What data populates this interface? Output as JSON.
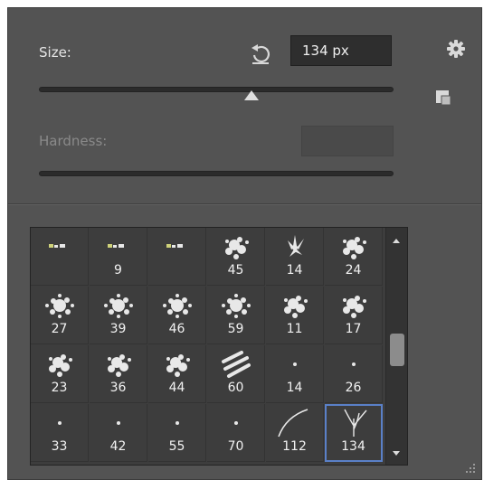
{
  "brush_panel": {
    "size_label": "Size:",
    "size_value": "134 px",
    "size_slider_fraction": 0.6,
    "hardness_label": "Hardness:",
    "hardness_value": "",
    "hardness_slider_fraction": null,
    "icons": [
      "reset-icon",
      "gear-icon",
      "preset-options-icon",
      "resize-grip-icon"
    ],
    "accent_color": "#5a80c8"
  },
  "brush_presets": {
    "rows": [
      [
        {
          "size": "",
          "brush": "small-dabs"
        },
        {
          "size": "9",
          "brush": "small-dabs"
        },
        {
          "size": "",
          "brush": "small-dabs"
        },
        {
          "size": "45",
          "brush": "splatter"
        },
        {
          "size": "14",
          "brush": "spikes"
        },
        {
          "size": "24",
          "brush": "splatter"
        }
      ],
      [
        {
          "size": "27",
          "brush": "spray"
        },
        {
          "size": "39",
          "brush": "spray"
        },
        {
          "size": "46",
          "brush": "spray"
        },
        {
          "size": "59",
          "brush": "spray"
        },
        {
          "size": "11",
          "brush": "splatter"
        },
        {
          "size": "17",
          "brush": "splatter"
        }
      ],
      [
        {
          "size": "23",
          "brush": "splatter"
        },
        {
          "size": "36",
          "brush": "splatter"
        },
        {
          "size": "44",
          "brush": "splatter"
        },
        {
          "size": "60",
          "brush": "streaks"
        },
        {
          "size": "14",
          "brush": "dot"
        },
        {
          "size": "26",
          "brush": "dot"
        }
      ],
      [
        {
          "size": "33",
          "brush": "dot"
        },
        {
          "size": "42",
          "brush": "dot"
        },
        {
          "size": "55",
          "brush": "dot"
        },
        {
          "size": "70",
          "brush": "dot"
        },
        {
          "size": "112",
          "brush": "curve-stroke"
        },
        {
          "size": "134",
          "brush": "grass-stroke",
          "selected": true
        }
      ]
    ],
    "scroll_position_fraction": 0.55
  }
}
